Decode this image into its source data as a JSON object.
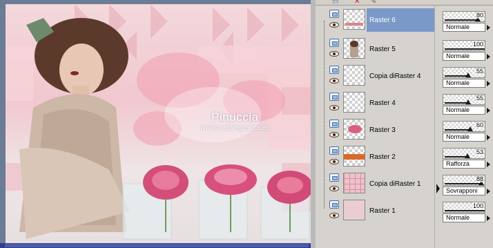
{
  "canvas": {
    "watermark_title": "Pinuccia",
    "watermark_url": "www.maidiregrafica.eu"
  },
  "layers": [
    {
      "name": "Raster 6",
      "selected": true,
      "thumb": "hearts-strip",
      "opacity": 80,
      "blend": "Normale"
    },
    {
      "name": "Raster 5",
      "selected": false,
      "thumb": "woman",
      "opacity": 100,
      "blend": "Normale"
    },
    {
      "name": "Copia diRaster 4",
      "selected": false,
      "thumb": "transparent",
      "opacity": 55,
      "blend": "Normale"
    },
    {
      "name": "Raster 4",
      "selected": false,
      "thumb": "transparent",
      "opacity": 55,
      "blend": "Normale"
    },
    {
      "name": "Raster 3",
      "selected": false,
      "thumb": "flowers",
      "opacity": 60,
      "blend": "Normale"
    },
    {
      "name": "Raster 2",
      "selected": false,
      "thumb": "orange-band",
      "opacity": 53,
      "blend": "Rafforza"
    },
    {
      "name": "Copia diRaster 1",
      "selected": false,
      "thumb": "pink-grid",
      "opacity": 88,
      "blend": "Sovrapponi"
    },
    {
      "name": "Raster 1",
      "selected": false,
      "thumb": "solid-pink",
      "opacity": 100,
      "blend": "Normale"
    }
  ],
  "colors": {
    "selected_row": "#7b99c8",
    "panel_bg": "#d6d3ce",
    "raster1_fill": "#e9cdd0",
    "raster2_band": "#d9692a"
  }
}
